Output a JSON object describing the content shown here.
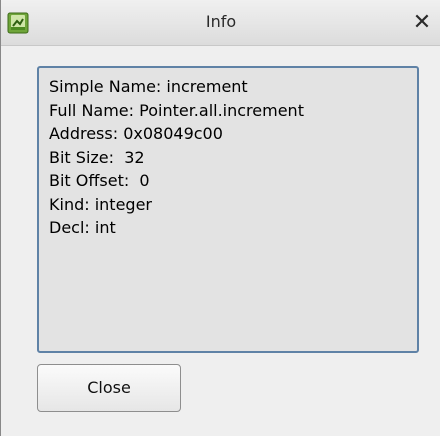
{
  "window": {
    "title": "Info",
    "app_icon": "app-icon",
    "close_icon": "close-x-icon",
    "close_glyph": "✕"
  },
  "info": {
    "lines": [
      "Simple Name: increment",
      "Full Name: Pointer.all.increment",
      "Address: 0x08049c00",
      "Bit Size:  32",
      "Bit Offset:  0",
      "Kind: integer",
      "Decl: int"
    ]
  },
  "buttons": {
    "close_label": "Close"
  },
  "colors": {
    "box_border": "#5f82a6",
    "box_background": "#e3e3e3",
    "window_background": "#efefef"
  }
}
